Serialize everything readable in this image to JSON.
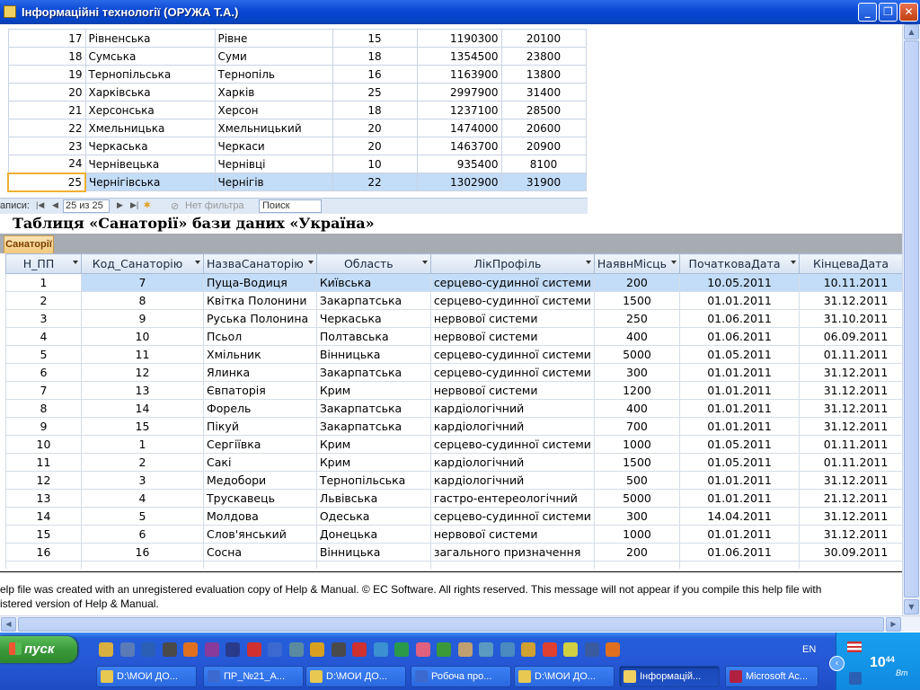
{
  "window": {
    "title": "Інформаційні технології (ОРУЖА Т.А.)"
  },
  "top_table": {
    "rows": [
      [
        "17",
        "Рівненська",
        "Рівне",
        "15",
        "1190300",
        "20100"
      ],
      [
        "18",
        "Сумська",
        "Суми",
        "18",
        "1354500",
        "23800"
      ],
      [
        "19",
        "Тернопільська",
        "Тернопіль",
        "16",
        "1163900",
        "13800"
      ],
      [
        "20",
        "Харківська",
        "Харків",
        "25",
        "2997900",
        "31400"
      ],
      [
        "21",
        "Херсонська",
        "Херсон",
        "18",
        "1237100",
        "28500"
      ],
      [
        "22",
        "Хмельницька",
        "Хмельницький",
        "20",
        "1474000",
        "20600"
      ],
      [
        "23",
        "Черкаська",
        "Черкаси",
        "20",
        "1463700",
        "20900"
      ],
      [
        "24",
        "Чернівецька",
        "Чернівці",
        "10",
        "935400",
        "8100"
      ],
      [
        "25",
        "Чернігівська",
        "Чернігів",
        "22",
        "1302900",
        "31900"
      ]
    ],
    "nav": {
      "label": "аписи:",
      "position": "25 из 25",
      "filter": "Нет фильтра",
      "search": "Поиск"
    }
  },
  "heading": "Таблиця «Санаторії» бази даних «Україна»",
  "tab_label": "Санаторії",
  "main_table": {
    "headers": [
      "Н_ПП",
      "Код_Санаторію",
      "НазваСанаторію",
      "Область",
      "ЛікПрофіль",
      "НаявнМісць",
      "ПочатковаДата",
      "КінцеваДата"
    ],
    "rows": [
      [
        "1",
        "7",
        "Пуща-Водиця",
        "Київська",
        "серцево-судинної системи",
        "200",
        "10.05.2011",
        "10.11.2011"
      ],
      [
        "2",
        "8",
        "Квітка Полонини",
        "Закарпатська",
        "серцево-судинної системи",
        "1500",
        "01.01.2011",
        "31.12.2011"
      ],
      [
        "3",
        "9",
        "Руська Полонина",
        "Черкаська",
        "нервової системи",
        "250",
        "01.06.2011",
        "31.10.2011"
      ],
      [
        "4",
        "10",
        "Псьол",
        "Полтавська",
        "нервової системи",
        "400",
        "01.06.2011",
        "06.09.2011"
      ],
      [
        "5",
        "11",
        "Хмільник",
        "Вінницька",
        "серцево-судинної системи",
        "5000",
        "01.05.2011",
        "01.11.2011"
      ],
      [
        "6",
        "12",
        "Ялинка",
        "Закарпатська",
        "серцево-судинної системи",
        "300",
        "01.01.2011",
        "31.12.2011"
      ],
      [
        "7",
        "13",
        "Євпаторія",
        "Крим",
        "нервової системи",
        "1200",
        "01.01.2011",
        "31.12.2011"
      ],
      [
        "8",
        "14",
        "Форель",
        "Закарпатська",
        "кардіологічний",
        "400",
        "01.01.2011",
        "31.12.2011"
      ],
      [
        "9",
        "15",
        "Пікуй",
        "Закарпатська",
        "кардіологічний",
        "700",
        "01.01.2011",
        "31.12.2011"
      ],
      [
        "10",
        "1",
        "Сергіївка",
        "Крим",
        "серцево-судинної системи",
        "1000",
        "01.05.2011",
        "01.11.2011"
      ],
      [
        "11",
        "2",
        "Сакі",
        "Крим",
        "кардіологічний",
        "1500",
        "01.05.2011",
        "01.11.2011"
      ],
      [
        "12",
        "3",
        "Медобори",
        "Тернопільська",
        "кардіологічний",
        "500",
        "01.01.2011",
        "31.12.2011"
      ],
      [
        "13",
        "4",
        "Трускавець",
        "Львівська",
        "гастро-ентереологічний",
        "5000",
        "01.01.2011",
        "21.12.2011"
      ],
      [
        "14",
        "5",
        "Молдова",
        "Одеська",
        "серцево-судинної системи",
        "300",
        "14.04.2011",
        "31.12.2011"
      ],
      [
        "15",
        "6",
        "Слов'янський",
        "Донецька",
        "нервової системи",
        "1000",
        "01.01.2011",
        "31.12.2011"
      ],
      [
        "16",
        "16",
        "Сосна",
        "Вінницька",
        "загального призначення",
        "200",
        "01.06.2011",
        "30.09.2011"
      ]
    ]
  },
  "footer": {
    "line1": "elp file was created with an unregistered evaluation copy of Help & Manual. © EC Software. All rights reserved. This message will not appear if you compile this help file with",
    "line2": "istered version of Help & Manual."
  },
  "taskbar": {
    "start_label": "пуск",
    "tasks": [
      "D:\\МОИ ДО...",
      "ПР_№21_А...",
      "D:\\МОИ ДО...",
      "Робоча про...",
      "D:\\МОИ ДО...",
      "Інформацій...",
      "Microsoft Ac..."
    ],
    "lang": "EN",
    "time_hours": "10",
    "time_minutes": "44",
    "day": "Вт"
  }
}
